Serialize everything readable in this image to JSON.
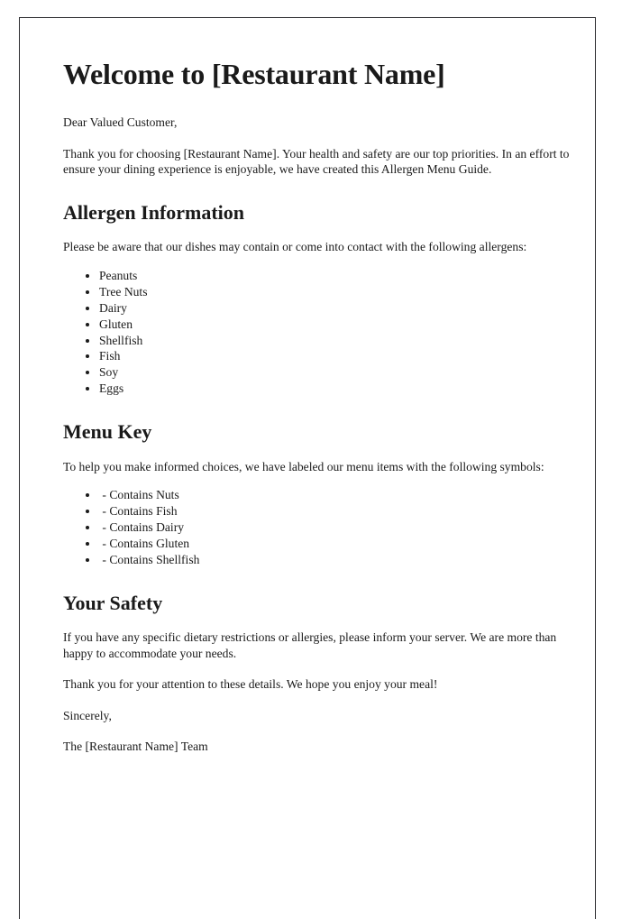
{
  "document": {
    "title": "Welcome to [Restaurant Name]",
    "greeting": "Dear Valued Customer,",
    "intro": "Thank you for choosing [Restaurant Name]. Your health and safety are our top priorities. In an effort to ensure your dining experience is enjoyable, we have created this Allergen Menu Guide.",
    "border_color": "#2b2b2e",
    "text_color": "#1a1a1a",
    "background_color": "#ffffff"
  },
  "allergen_section": {
    "heading": "Allergen Information",
    "intro": "Please be aware that our dishes may contain or come into contact with the following allergens:",
    "items": [
      "Peanuts",
      "Tree Nuts",
      "Dairy",
      "Gluten",
      "Shellfish",
      "Fish",
      "Soy",
      "Eggs"
    ]
  },
  "menu_key_section": {
    "heading": "Menu Key",
    "intro": "To help you make informed choices, we have labeled our menu items with the following symbols:",
    "items": [
      " - Contains Nuts",
      " - Contains Fish",
      " - Contains Dairy",
      " - Contains Gluten",
      " - Contains Shellfish"
    ]
  },
  "safety_section": {
    "heading": "Your Safety",
    "paragraph": "If you have any specific dietary restrictions or allergies, please inform your server. We are more than happy to accommodate your needs.",
    "closing": "Thank you for your attention to these details. We hope you enjoy your meal!",
    "sign_off": "Sincerely,",
    "signature": "The [Restaurant Name] Team"
  }
}
